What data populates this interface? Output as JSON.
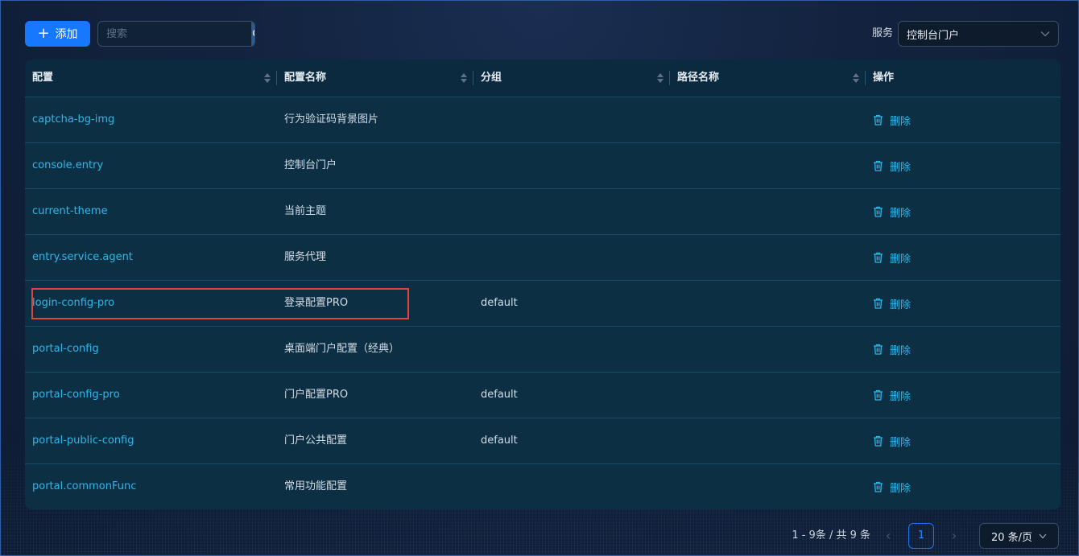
{
  "toolbar": {
    "add_label": "添加",
    "search_placeholder": "搜索",
    "service_label": "服务",
    "service_value": "控制台门户"
  },
  "table": {
    "headers": [
      "配置",
      "配置名称",
      "分组",
      "路径名称",
      "操作"
    ],
    "rows": [
      {
        "key": "captcha-bg-img",
        "name": "行为验证码背景图片",
        "group": "",
        "path": "",
        "action": "删除"
      },
      {
        "key": "console.entry",
        "name": "控制台门户",
        "group": "",
        "path": "",
        "action": "删除"
      },
      {
        "key": "current-theme",
        "name": "当前主题",
        "group": "",
        "path": "",
        "action": "删除"
      },
      {
        "key": "entry.service.agent",
        "name": "服务代理",
        "group": "",
        "path": "",
        "action": "删除"
      },
      {
        "key": "login-config-pro",
        "name": "登录配置PRO",
        "group": "default",
        "path": "",
        "action": "删除"
      },
      {
        "key": "portal-config",
        "name": "桌面端门户配置（经典）",
        "group": "",
        "path": "",
        "action": "删除"
      },
      {
        "key": "portal-config-pro",
        "name": "门户配置PRO",
        "group": "default",
        "path": "",
        "action": "删除"
      },
      {
        "key": "portal-public-config",
        "name": "门户公共配置",
        "group": "default",
        "path": "",
        "action": "删除"
      },
      {
        "key": "portal.commonFunc",
        "name": "常用功能配置",
        "group": "",
        "path": "",
        "action": "删除"
      }
    ]
  },
  "pagination": {
    "total_text": "1 - 9条 / 共 9 条",
    "current_page": "1",
    "page_size": "20 条/页",
    "prev": "‹",
    "next": "›"
  },
  "colors": {
    "primary": "#1677ff",
    "link": "#2fb6e8",
    "highlight_border": "#e0443a"
  }
}
